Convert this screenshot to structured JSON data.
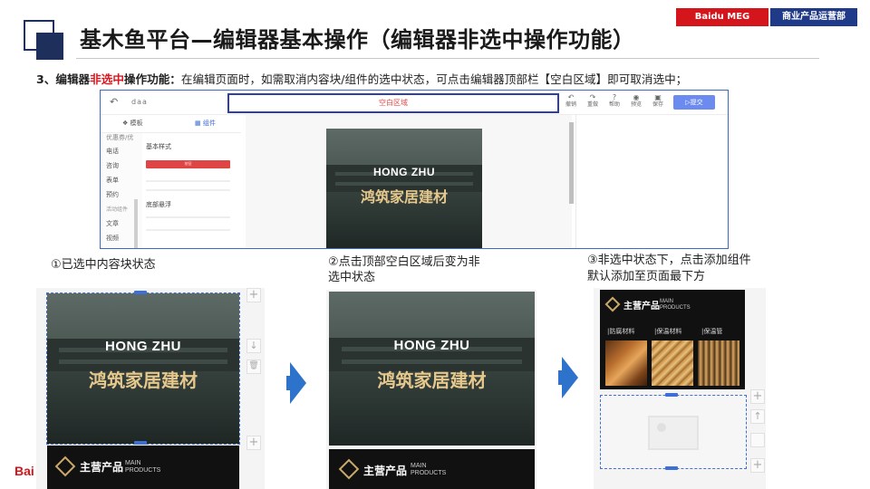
{
  "header": {
    "title": "基木鱼平台—编辑器基本操作（编辑器非选中操作功能）",
    "badge_left": "Baidu MEG",
    "badge_right": "商业产品运营部"
  },
  "description": {
    "prefix": "3、编辑器",
    "highlight": "非选中",
    "bold_suffix": "操作功能：",
    "text": "在编辑页面时，如需取消内容块/组件的选中状态，可点击编辑器顶部栏【空白区域】即可取消选中；"
  },
  "editor": {
    "back_icon": "undo-arrow-icon",
    "page_name": "daa",
    "blank_area_label": "空白区域",
    "tools": [
      {
        "label": "撤销",
        "icon": "undo-icon"
      },
      {
        "label": "重做",
        "icon": "redo-icon"
      },
      {
        "label": "帮助",
        "icon": "help-icon"
      },
      {
        "label": "预览",
        "icon": "eye-icon"
      },
      {
        "label": "保存",
        "icon": "save-icon"
      }
    ],
    "submit_label": "▷提交",
    "tabs": [
      {
        "label": "模板",
        "icon": "template-icon"
      },
      {
        "label": "组件",
        "icon": "grid-icon"
      }
    ],
    "left_items": [
      "优惠券/优",
      "电话",
      "咨询",
      "表单",
      "预约",
      "活动组件",
      "文章",
      "视频"
    ],
    "mid_labels": [
      "基本样式",
      "底部悬浮"
    ],
    "mid_red_label": "按钮"
  },
  "hero": {
    "en": "HONG ZHU",
    "cn": "鸿筑家居建材"
  },
  "product": {
    "cn": "主营产品",
    "en_line1": "MAIN",
    "en_line2": "PRODUCTS",
    "tags": [
      "|防腐材料",
      "|保温材料",
      "|保温管"
    ]
  },
  "captions": {
    "step1": "①已选中内容块状态",
    "step2_line1": "②点击顶部空白区域后变为非",
    "step2_line2": "选中状态",
    "step3_line1": "③非选中状态下，点击添加组件",
    "step3_line2": "默认添加至页面最下方"
  },
  "side_controls": {
    "add": "+",
    "down": "↓",
    "delete": "🗑"
  },
  "footer_logo": "Bai",
  "colors": {
    "brand_red": "#d4151c",
    "brand_blue": "#1f3a88",
    "accent_blue": "#2e73cb",
    "gold": "#e6c88c"
  }
}
